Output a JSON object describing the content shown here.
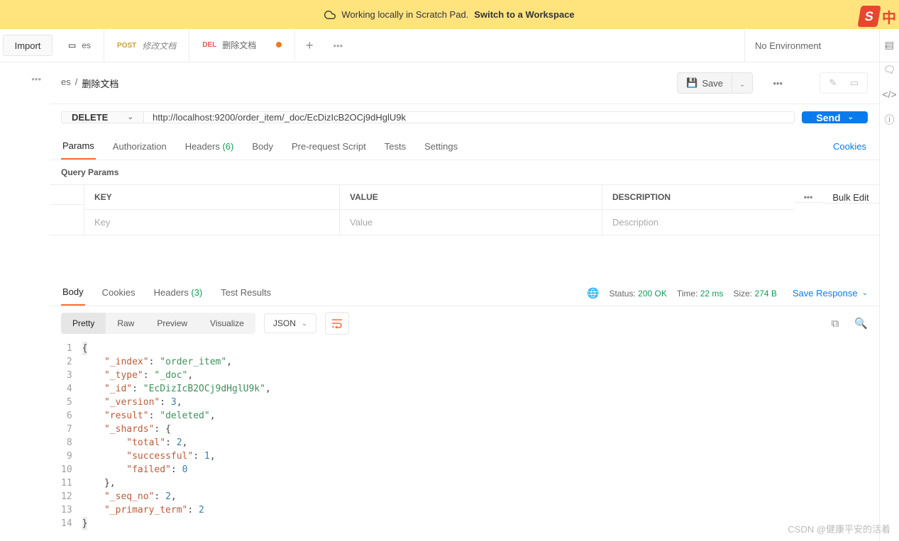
{
  "banner": {
    "text": "Working locally in Scratch Pad.",
    "cta": "Switch to a Workspace"
  },
  "import_label": "Import",
  "tabs": [
    {
      "icon": "collection",
      "label": "es"
    },
    {
      "method": "POST",
      "label": "修改文档"
    },
    {
      "method": "DEL",
      "label": "删除文档",
      "dirty": true
    }
  ],
  "env": {
    "label": "No Environment"
  },
  "breadcrumb": {
    "parent": "es",
    "title": "删除文档"
  },
  "save_label": "Save",
  "request": {
    "method": "DELETE",
    "url": "http://localhost:9200/order_item/_doc/EcDizIcB2OCj9dHglU9k",
    "send": "Send",
    "tabs": {
      "params": "Params",
      "authorization": "Authorization",
      "headers": "Headers",
      "headers_count": "(6)",
      "body": "Body",
      "prerequest": "Pre-request Script",
      "tests": "Tests",
      "settings": "Settings"
    },
    "cookies": "Cookies"
  },
  "query_params": {
    "section": "Query Params",
    "th_key": "KEY",
    "th_value": "VALUE",
    "th_desc": "DESCRIPTION",
    "bulk": "Bulk Edit",
    "ph_key": "Key",
    "ph_value": "Value",
    "ph_desc": "Description"
  },
  "response": {
    "tabs": {
      "body": "Body",
      "cookies": "Cookies",
      "headers": "Headers",
      "headers_count": "(3)",
      "tests": "Test Results"
    },
    "status_label": "Status:",
    "status_value": "200 OK",
    "time_label": "Time:",
    "time_value": "22 ms",
    "size_label": "Size:",
    "size_value": "274 B",
    "save_response": "Save Response",
    "pills": {
      "pretty": "Pretty",
      "raw": "Raw",
      "preview": "Preview",
      "visualize": "Visualize"
    },
    "format": "JSON"
  },
  "body_json": {
    "_index": "order_item",
    "_type": "_doc",
    "_id": "EcDizIcB2OCj9dHglU9k",
    "_version": 3,
    "result": "deleted",
    "_shards": {
      "total": 2,
      "successful": 1,
      "failed": 0
    },
    "_seq_no": 2,
    "_primary_term": 2
  },
  "watermark": "CSDN @健康平安的活着"
}
